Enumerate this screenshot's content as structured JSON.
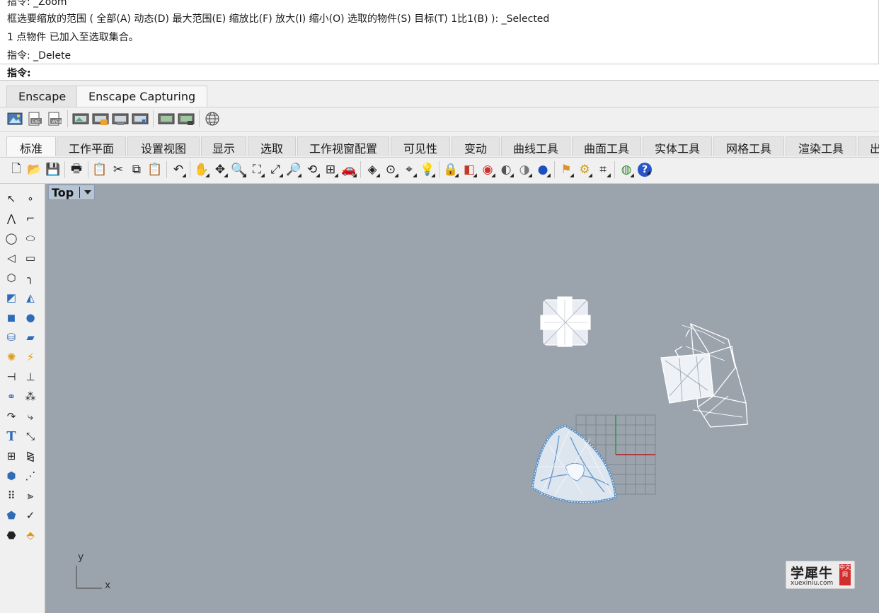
{
  "command_history": {
    "lines": [
      "指令: _Zoom",
      "框选要缩放的范围 ( 全部(A)  动态(D)  最大范围(E)  缩放比(F)  放大(I)  缩小(O)  选取的物件(S)  目标(T)  1比1(B) ): _Selected",
      "1 点物件 已加入至选取集合。",
      "指令: _Delete"
    ],
    "prompt_label": "指令:",
    "input_value": ""
  },
  "plugin_tabs": [
    {
      "label": "Enscape",
      "active": false
    },
    {
      "label": "Enscape Capturing",
      "active": true
    }
  ],
  "plugin_tool_icons": [
    "enscape-capture-icon",
    "enscape-export-exe-icon",
    "enscape-export-web-icon",
    "enscape-render-image-icon",
    "enscape-batch-render-icon",
    "enscape-render-panorama-icon",
    "enscape-render-video-icon",
    "enscape-view-list-icon",
    "enscape-upload-icon",
    "enscape-web-standalone-icon"
  ],
  "main_tabs": [
    {
      "label": "标准",
      "active": true
    },
    {
      "label": "工作平面",
      "active": false
    },
    {
      "label": "设置视图",
      "active": false
    },
    {
      "label": "显示",
      "active": false
    },
    {
      "label": "选取",
      "active": false
    },
    {
      "label": "工作视窗配置",
      "active": false
    },
    {
      "label": "可见性",
      "active": false
    },
    {
      "label": "变动",
      "active": false
    },
    {
      "label": "曲线工具",
      "active": false
    },
    {
      "label": "曲面工具",
      "active": false
    },
    {
      "label": "实体工具",
      "active": false
    },
    {
      "label": "网格工具",
      "active": false
    },
    {
      "label": "渲染工具",
      "active": false
    },
    {
      "label": "出",
      "active": false
    }
  ],
  "main_toolbar_icons": [
    {
      "name": "new-file-icon",
      "glyph": "🗋"
    },
    {
      "name": "open-folder-icon",
      "glyph": "📂"
    },
    {
      "name": "save-icon",
      "glyph": "💾"
    },
    {
      "name": "print-icon",
      "glyph": "🖶"
    },
    {
      "name": "clipboard-copy-icon",
      "glyph": "📋"
    },
    {
      "name": "cut-icon",
      "glyph": "✂"
    },
    {
      "name": "copy-icon",
      "glyph": "⧉"
    },
    {
      "name": "paste-icon",
      "glyph": "📋"
    },
    {
      "name": "undo-icon",
      "glyph": "↶"
    },
    {
      "name": "pan-hand-icon",
      "glyph": "✋"
    },
    {
      "name": "rotate-view-icon",
      "glyph": "✥"
    },
    {
      "name": "zoom-icon",
      "glyph": "🔍"
    },
    {
      "name": "zoom-window-icon",
      "glyph": "⛶"
    },
    {
      "name": "zoom-extents-icon",
      "glyph": "⤢"
    },
    {
      "name": "zoom-selected-icon",
      "glyph": "🔎"
    },
    {
      "name": "undo-view-icon",
      "glyph": "⟲"
    },
    {
      "name": "four-viewports-icon",
      "glyph": "⊞"
    },
    {
      "name": "car-named-views-icon",
      "glyph": "🚗"
    },
    {
      "name": "camera-icon",
      "glyph": "◈"
    },
    {
      "name": "construction-plane-icon",
      "glyph": "⊙"
    },
    {
      "name": "object-snap-icon",
      "glyph": "⌖"
    },
    {
      "name": "light-bulb-icon",
      "glyph": "💡"
    },
    {
      "name": "lock-icon",
      "glyph": "🔒"
    },
    {
      "name": "layer-icon",
      "glyph": "◧"
    },
    {
      "name": "color-wheel-icon",
      "glyph": "◉"
    },
    {
      "name": "shaded-sphere-icon",
      "glyph": "◐"
    },
    {
      "name": "rendered-sphere-icon",
      "glyph": "◑"
    },
    {
      "name": "blue-sphere-icon",
      "glyph": "●"
    },
    {
      "name": "render-icon",
      "glyph": "⚑"
    },
    {
      "name": "gear-options-icon",
      "glyph": "⚙"
    },
    {
      "name": "dimension-icon",
      "glyph": "⌗"
    },
    {
      "name": "grasshopper-icon",
      "glyph": "◍"
    },
    {
      "name": "help-icon",
      "glyph": "?"
    }
  ],
  "left_toolbar_icons": [
    "select-arrow-icon",
    "point-icon",
    "polyline-icon",
    "curve-control-points-icon",
    "circle-icon",
    "ellipse-icon",
    "arc-icon",
    "rectangle-icon",
    "polygon-icon",
    "fillet-curve-icon",
    "surface-from-points-icon",
    "extrude-surface-icon",
    "box-solid-icon",
    "sphere-solid-icon",
    "cylinder-solid-icon",
    "mesh-surface-icon",
    "boolean-gear-icon",
    "warning-analyze-icon",
    "split-icon",
    "trim-icon",
    "boolean-union-icon",
    "group-icon",
    "offset-curve-icon",
    "rebuild-curve-icon",
    "text-icon",
    "dimension-points-icon",
    "array-icon",
    "mirror-icon",
    "block-icon",
    "grid-snap-icon",
    "array-polar-icon",
    "ruler-icon",
    "cage-edit-icon",
    "check-icon",
    "render-object-icon",
    "material-icon"
  ],
  "viewport": {
    "title": "Top",
    "axis_y": "y",
    "axis_x": "x",
    "background": "#9ba3ad"
  },
  "watermark": {
    "main_text": "学犀牛",
    "sub_text": "xuexiniu.com",
    "badge_text": "中文网"
  }
}
